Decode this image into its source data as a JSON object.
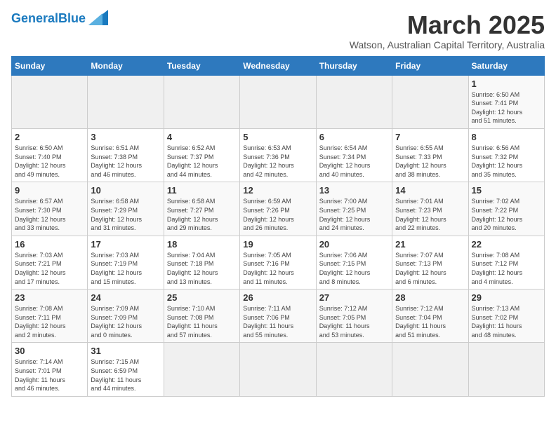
{
  "header": {
    "logo_general": "General",
    "logo_blue": "Blue",
    "month_title": "March 2025",
    "subtitle": "Watson, Australian Capital Territory, Australia"
  },
  "weekdays": [
    "Sunday",
    "Monday",
    "Tuesday",
    "Wednesday",
    "Thursday",
    "Friday",
    "Saturday"
  ],
  "weeks": [
    [
      {
        "day": "",
        "info": ""
      },
      {
        "day": "",
        "info": ""
      },
      {
        "day": "",
        "info": ""
      },
      {
        "day": "",
        "info": ""
      },
      {
        "day": "",
        "info": ""
      },
      {
        "day": "",
        "info": ""
      },
      {
        "day": "1",
        "info": "Sunrise: 6:50 AM\nSunset: 7:41 PM\nDaylight: 12 hours\nand 51 minutes."
      }
    ],
    [
      {
        "day": "2",
        "info": "Sunrise: 6:50 AM\nSunset: 7:40 PM\nDaylight: 12 hours\nand 49 minutes."
      },
      {
        "day": "3",
        "info": "Sunrise: 6:51 AM\nSunset: 7:38 PM\nDaylight: 12 hours\nand 46 minutes."
      },
      {
        "day": "4",
        "info": "Sunrise: 6:52 AM\nSunset: 7:37 PM\nDaylight: 12 hours\nand 44 minutes."
      },
      {
        "day": "5",
        "info": "Sunrise: 6:53 AM\nSunset: 7:36 PM\nDaylight: 12 hours\nand 42 minutes."
      },
      {
        "day": "6",
        "info": "Sunrise: 6:54 AM\nSunset: 7:34 PM\nDaylight: 12 hours\nand 40 minutes."
      },
      {
        "day": "7",
        "info": "Sunrise: 6:55 AM\nSunset: 7:33 PM\nDaylight: 12 hours\nand 38 minutes."
      },
      {
        "day": "8",
        "info": "Sunrise: 6:56 AM\nSunset: 7:32 PM\nDaylight: 12 hours\nand 35 minutes."
      }
    ],
    [
      {
        "day": "9",
        "info": "Sunrise: 6:57 AM\nSunset: 7:30 PM\nDaylight: 12 hours\nand 33 minutes."
      },
      {
        "day": "10",
        "info": "Sunrise: 6:58 AM\nSunset: 7:29 PM\nDaylight: 12 hours\nand 31 minutes."
      },
      {
        "day": "11",
        "info": "Sunrise: 6:58 AM\nSunset: 7:27 PM\nDaylight: 12 hours\nand 29 minutes."
      },
      {
        "day": "12",
        "info": "Sunrise: 6:59 AM\nSunset: 7:26 PM\nDaylight: 12 hours\nand 26 minutes."
      },
      {
        "day": "13",
        "info": "Sunrise: 7:00 AM\nSunset: 7:25 PM\nDaylight: 12 hours\nand 24 minutes."
      },
      {
        "day": "14",
        "info": "Sunrise: 7:01 AM\nSunset: 7:23 PM\nDaylight: 12 hours\nand 22 minutes."
      },
      {
        "day": "15",
        "info": "Sunrise: 7:02 AM\nSunset: 7:22 PM\nDaylight: 12 hours\nand 20 minutes."
      }
    ],
    [
      {
        "day": "16",
        "info": "Sunrise: 7:03 AM\nSunset: 7:21 PM\nDaylight: 12 hours\nand 17 minutes."
      },
      {
        "day": "17",
        "info": "Sunrise: 7:03 AM\nSunset: 7:19 PM\nDaylight: 12 hours\nand 15 minutes."
      },
      {
        "day": "18",
        "info": "Sunrise: 7:04 AM\nSunset: 7:18 PM\nDaylight: 12 hours\nand 13 minutes."
      },
      {
        "day": "19",
        "info": "Sunrise: 7:05 AM\nSunset: 7:16 PM\nDaylight: 12 hours\nand 11 minutes."
      },
      {
        "day": "20",
        "info": "Sunrise: 7:06 AM\nSunset: 7:15 PM\nDaylight: 12 hours\nand 8 minutes."
      },
      {
        "day": "21",
        "info": "Sunrise: 7:07 AM\nSunset: 7:13 PM\nDaylight: 12 hours\nand 6 minutes."
      },
      {
        "day": "22",
        "info": "Sunrise: 7:08 AM\nSunset: 7:12 PM\nDaylight: 12 hours\nand 4 minutes."
      }
    ],
    [
      {
        "day": "23",
        "info": "Sunrise: 7:08 AM\nSunset: 7:11 PM\nDaylight: 12 hours\nand 2 minutes."
      },
      {
        "day": "24",
        "info": "Sunrise: 7:09 AM\nSunset: 7:09 PM\nDaylight: 12 hours\nand 0 minutes."
      },
      {
        "day": "25",
        "info": "Sunrise: 7:10 AM\nSunset: 7:08 PM\nDaylight: 11 hours\nand 57 minutes."
      },
      {
        "day": "26",
        "info": "Sunrise: 7:11 AM\nSunset: 7:06 PM\nDaylight: 11 hours\nand 55 minutes."
      },
      {
        "day": "27",
        "info": "Sunrise: 7:12 AM\nSunset: 7:05 PM\nDaylight: 11 hours\nand 53 minutes."
      },
      {
        "day": "28",
        "info": "Sunrise: 7:12 AM\nSunset: 7:04 PM\nDaylight: 11 hours\nand 51 minutes."
      },
      {
        "day": "29",
        "info": "Sunrise: 7:13 AM\nSunset: 7:02 PM\nDaylight: 11 hours\nand 48 minutes."
      }
    ],
    [
      {
        "day": "30",
        "info": "Sunrise: 7:14 AM\nSunset: 7:01 PM\nDaylight: 11 hours\nand 46 minutes."
      },
      {
        "day": "31",
        "info": "Sunrise: 7:15 AM\nSunset: 6:59 PM\nDaylight: 11 hours\nand 44 minutes."
      },
      {
        "day": "",
        "info": ""
      },
      {
        "day": "",
        "info": ""
      },
      {
        "day": "",
        "info": ""
      },
      {
        "day": "",
        "info": ""
      },
      {
        "day": "",
        "info": ""
      }
    ]
  ]
}
